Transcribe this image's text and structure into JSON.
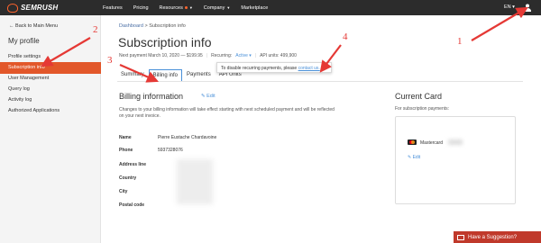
{
  "header": {
    "brand": "SEMRUSH",
    "nav": [
      {
        "label": "Features",
        "dot": false,
        "caret": false
      },
      {
        "label": "Pricing",
        "dot": false,
        "caret": false
      },
      {
        "label": "Resources",
        "dot": true,
        "caret": true
      },
      {
        "label": "Company",
        "dot": false,
        "caret": true
      },
      {
        "label": "Marketplace",
        "dot": false,
        "caret": false
      }
    ],
    "language": "EN ▾",
    "colors": {
      "bg": "#2c2c2c",
      "accent": "#ff642d"
    }
  },
  "sidebar": {
    "back": "← Back to Main Menu",
    "title": "My profile",
    "items": [
      {
        "label": "Profile settings",
        "active": false
      },
      {
        "label": "Subscription info",
        "active": true
      },
      {
        "label": "User Management",
        "active": false
      },
      {
        "label": "Query log",
        "active": false
      },
      {
        "label": "Activity log",
        "active": false
      },
      {
        "label": "Authorized Applications",
        "active": false
      }
    ],
    "active_color": "#e2572a"
  },
  "main": {
    "breadcrumb": {
      "root": "Dashboard",
      "sep": ">",
      "current": "Subscription info"
    },
    "title": "Subscription info",
    "meta": {
      "next_payment": "Next payment March 10, 2020 — $199.95",
      "recurring_label": "Recurring:",
      "recurring_value": "Active ▾",
      "api_units": "API units: 499,900"
    },
    "tooltip": {
      "text": "To disable recurring payments, please ",
      "link": "contact us."
    },
    "tabs": [
      {
        "label": "Summary",
        "active": false
      },
      {
        "label": "Billing info",
        "active": true
      },
      {
        "label": "Payments",
        "active": false
      },
      {
        "label": "API Units",
        "active": false
      }
    ],
    "billing": {
      "title": "Billing information",
      "edit": "✎ Edit",
      "description": "Changes to your billing information will take effect starting with next scheduled payment and will be reflected on your next invoice.",
      "rows": [
        {
          "label": "Name",
          "value": "Pierre Eustache Chardavoine"
        },
        {
          "label": "Phone",
          "value": "5937328076"
        },
        {
          "label": "Address line",
          "value": ""
        },
        {
          "label": "Country",
          "value": ""
        },
        {
          "label": "City",
          "value": ""
        },
        {
          "label": "Postal code",
          "value": ""
        }
      ]
    },
    "card": {
      "title": "Current Card",
      "subtitle": "For subscription payments:",
      "brand": "Mastercard",
      "edit": "✎ Edit"
    }
  },
  "suggestion_button": "Have a Suggestion?",
  "annotations": {
    "one": "1",
    "two": "2",
    "three": "3",
    "four": "4"
  }
}
